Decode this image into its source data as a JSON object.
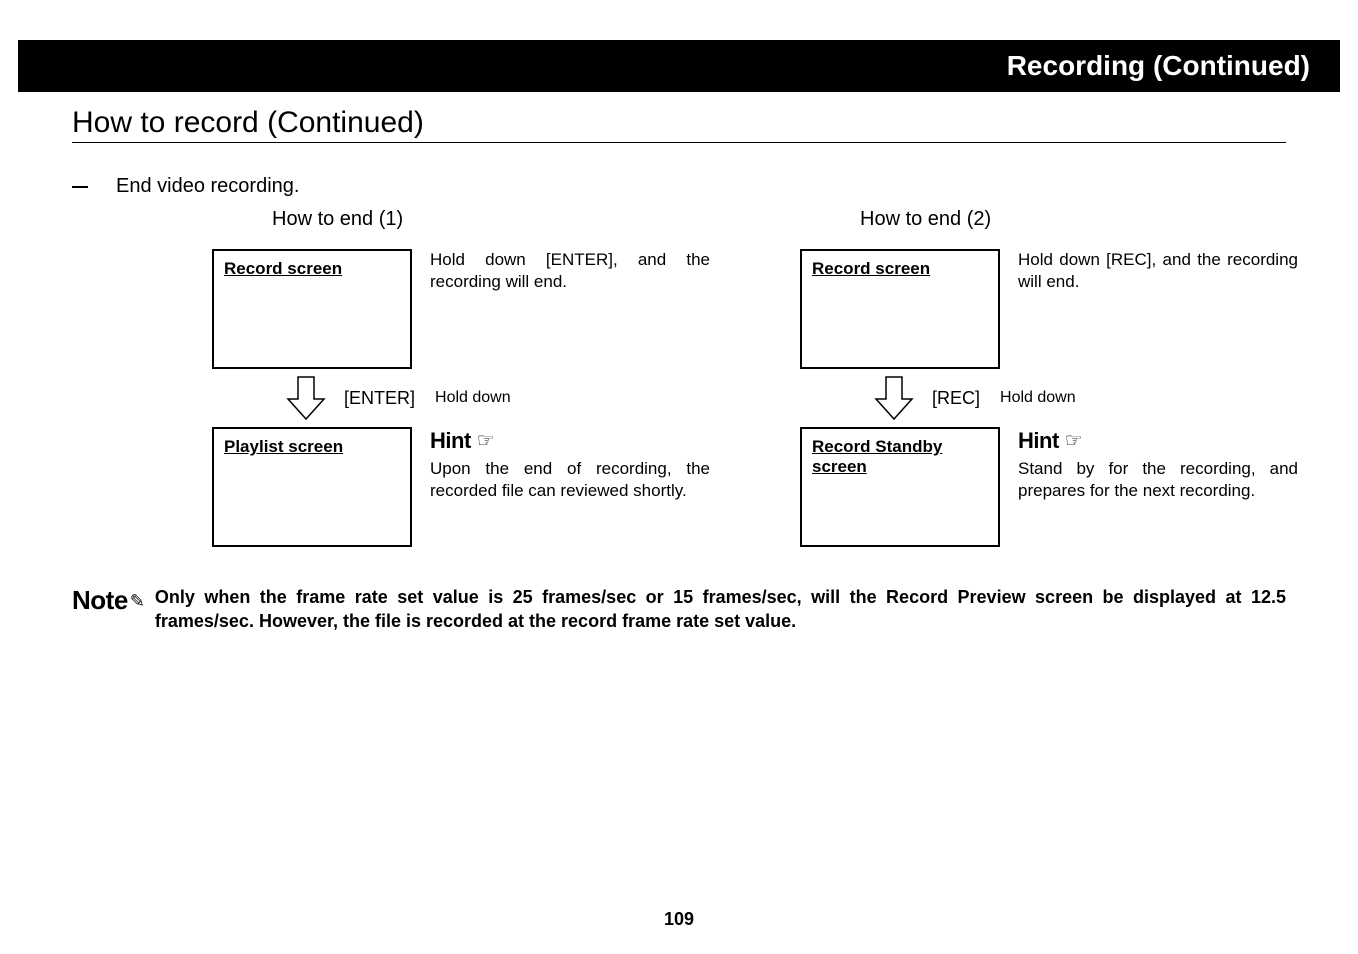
{
  "banner": "Recording (Continued)",
  "section_title": "How to record (Continued)",
  "step": "End video recording.",
  "col1": {
    "title": "How to end (1)",
    "box1_title": "Record screen",
    "desc1": "Hold down [ENTER], and the recording will end.",
    "arrow_label": "[ENTER]",
    "arrow_caption": "Hold down",
    "box2_title": "Playlist screen",
    "hint_label": "Hint",
    "desc2": "Upon the end of recording, the recorded file can reviewed shortly."
  },
  "col2": {
    "title": "How to end (2)",
    "box1_title": "Record screen",
    "desc1": "Hold down [REC], and the recording will end.",
    "arrow_label": "[REC]",
    "arrow_caption": "Hold down",
    "box2_title": "Record Standby screen",
    "hint_label": "Hint",
    "desc2": "Stand by for the recording, and prepares for the next recording."
  },
  "note": {
    "label": "Note",
    "text": "Only when the frame rate set value is 25 frames/sec or 15 frames/sec, will the Record Preview screen be displayed at 12.5 frames/sec. However, the file is recorded at the record frame rate set value."
  },
  "page_number": "109"
}
